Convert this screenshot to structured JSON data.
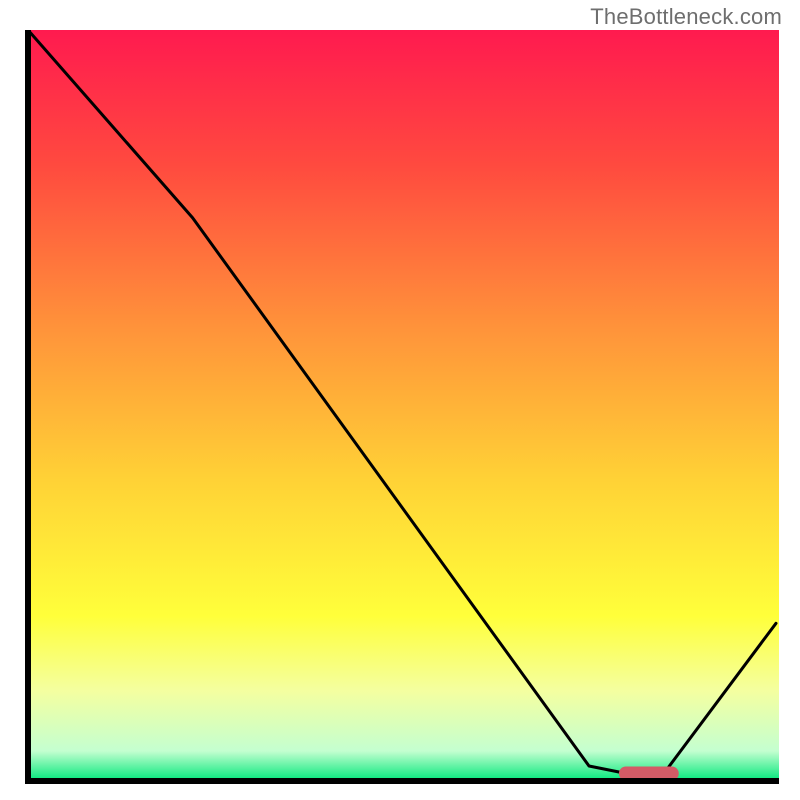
{
  "watermark": "TheBottleneck.com",
  "chart_data": {
    "type": "line",
    "title": "",
    "xlabel": "",
    "ylabel": "",
    "xlim": [
      0,
      100
    ],
    "ylim": [
      0,
      100
    ],
    "grid": false,
    "legend": false,
    "series": [
      {
        "name": "bottleneck-curve",
        "x": [
          0,
          22,
          75,
          80,
          85,
          100
        ],
        "values": [
          100,
          75,
          2,
          1,
          1,
          21
        ]
      }
    ],
    "annotations": [
      {
        "name": "optimum-marker",
        "type": "rounded-bar",
        "x_start": 79,
        "x_end": 87,
        "y": 1,
        "color": "#d35b66"
      }
    ],
    "background_gradient": {
      "stops": [
        {
          "offset": 0.0,
          "color": "#ff1a4f"
        },
        {
          "offset": 0.18,
          "color": "#ff4a3f"
        },
        {
          "offset": 0.4,
          "color": "#ff943a"
        },
        {
          "offset": 0.6,
          "color": "#ffd236"
        },
        {
          "offset": 0.78,
          "color": "#ffff3a"
        },
        {
          "offset": 0.88,
          "color": "#f4ffa0"
        },
        {
          "offset": 0.96,
          "color": "#c4ffd0"
        },
        {
          "offset": 1.0,
          "color": "#00e77a"
        }
      ]
    },
    "axis_stroke": "#000000",
    "axis_stroke_width": 6,
    "line_stroke": "#000000",
    "line_stroke_width": 3
  }
}
